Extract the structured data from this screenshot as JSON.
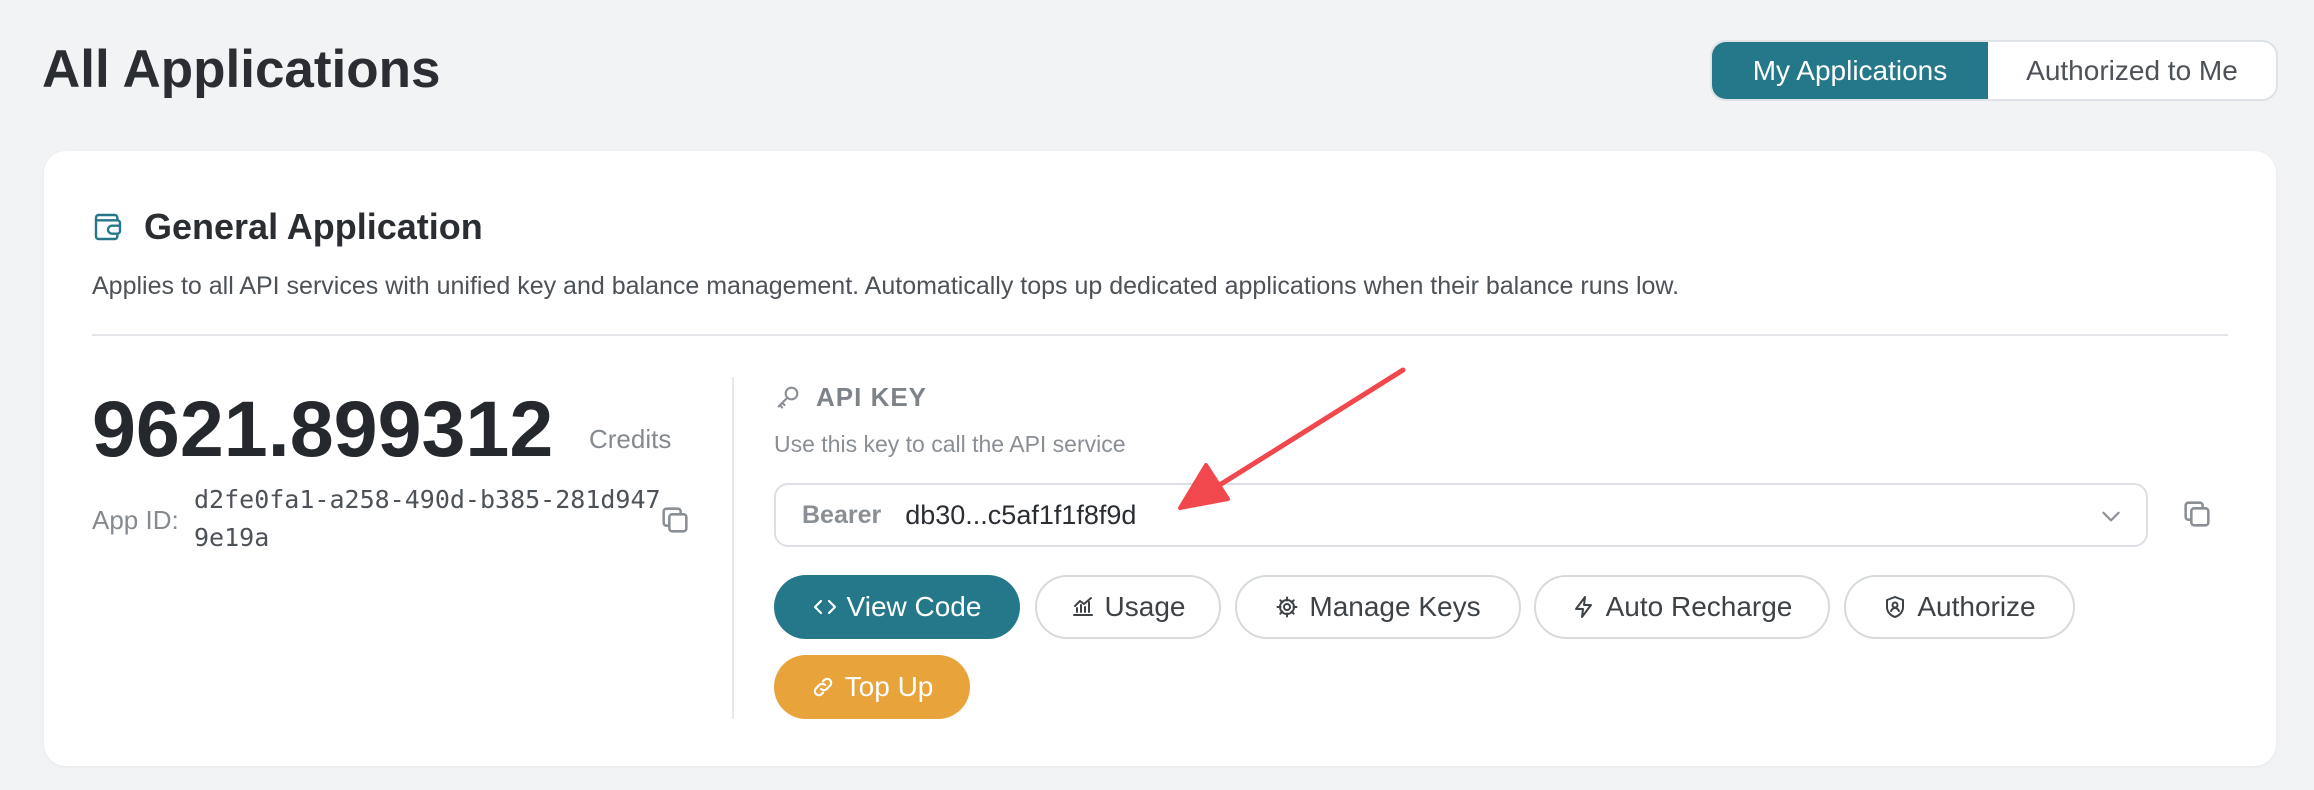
{
  "page": {
    "title": "All Applications"
  },
  "view_toggle": {
    "options": [
      "My Applications",
      "Authorized to Me"
    ],
    "selected": "My Applications"
  },
  "app": {
    "title": "General Application",
    "description": "Applies to all API services with unified key and balance management. Automatically tops up dedicated applications when their balance runs low.",
    "balance": "9621.899312",
    "balance_unit": "Credits",
    "app_id_label": "App ID:",
    "app_id": "d2fe0fa1-a258-490d-b385-281d9479e19a"
  },
  "api_key": {
    "label": "API KEY",
    "help": "Use this key to call the API service",
    "prefix": "Bearer",
    "value": "db30...c5af1f1f8f9d"
  },
  "actions": {
    "view_code": "View Code",
    "usage": "Usage",
    "manage_keys": "Manage Keys",
    "auto_recharge": "Auto Recharge",
    "authorize": "Authorize",
    "top_up": "Top Up"
  },
  "colors": {
    "accent": "#25788a",
    "warning": "#e8a33a",
    "annotation_arrow": "#f0484d"
  },
  "icons": [
    "wallet-icon",
    "copy-icon",
    "key-icon",
    "chevron-down-icon",
    "code-icon",
    "chart-icon",
    "gear-icon",
    "lightning-icon",
    "shield-icon",
    "link-icon",
    "arrow-annotation"
  ]
}
